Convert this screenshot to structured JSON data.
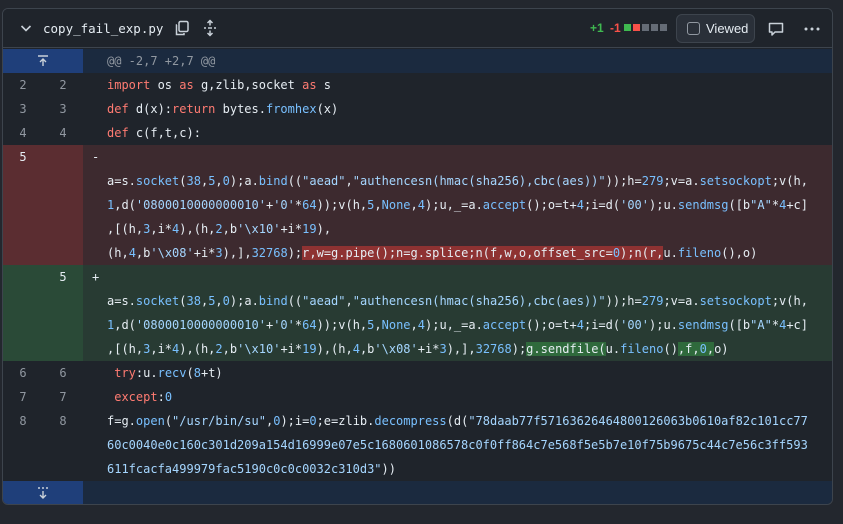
{
  "file": {
    "name": "copy_fail_exp.py",
    "additions": "+1",
    "deletions": "-1",
    "viewed_label": "Viewed",
    "block_colors": [
      "#3fb950",
      "#f85149",
      "#656c76",
      "#656c76",
      "#656c76"
    ]
  },
  "hunk": {
    "header": "@@ -2,7 +2,7 @@"
  },
  "lines": {
    "l2": {
      "old": "2",
      "new": "2"
    },
    "l3": {
      "old": "3",
      "new": "3"
    },
    "l4": {
      "old": "4",
      "new": "4"
    },
    "del": {
      "old": "5",
      "sign": "-"
    },
    "add": {
      "new": "5",
      "sign": "+"
    },
    "l6": {
      "old": "6",
      "new": "6"
    },
    "l7": {
      "old": "7",
      "new": "7"
    },
    "l8": {
      "old": "8",
      "new": "8"
    }
  }
}
